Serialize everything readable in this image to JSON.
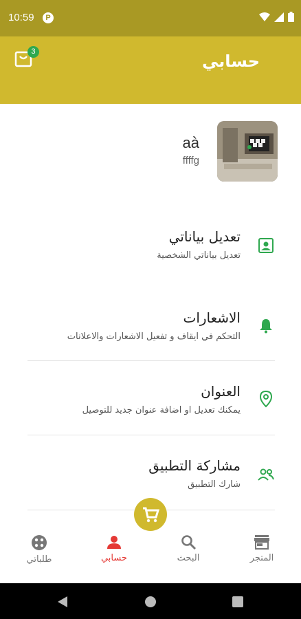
{
  "status_bar": {
    "time": "10:59",
    "app_badge": "P"
  },
  "app_bar": {
    "title": "حسابي",
    "cart_count": "3"
  },
  "profile": {
    "name": "aà",
    "subtitle": "ffffg"
  },
  "menu": [
    {
      "title": "تعديل بياناتي",
      "subtitle": "تعديل بياناتي الشخصية",
      "icon": "user-card-icon"
    },
    {
      "title": "الاشعارات",
      "subtitle": "التحكم في ايقاف و تفعيل الاشعارات والاعلانات",
      "icon": "bell-icon"
    },
    {
      "title": "العنوان",
      "subtitle": "يمكنك تعديل او اضافة عنوان جديد للتوصيل",
      "icon": "location-pin-icon"
    },
    {
      "title": "مشاركة التطبيق",
      "subtitle": "شارك التطبيق",
      "icon": "share-users-icon"
    }
  ],
  "bottom_nav": {
    "store": "المتجر",
    "search": "البحث",
    "account": "حسابي",
    "orders": "طلباتي"
  },
  "colors": {
    "primary": "#d0b92e",
    "status": "#a99924",
    "accent_green": "#2fa84f",
    "active_red": "#e53935"
  }
}
